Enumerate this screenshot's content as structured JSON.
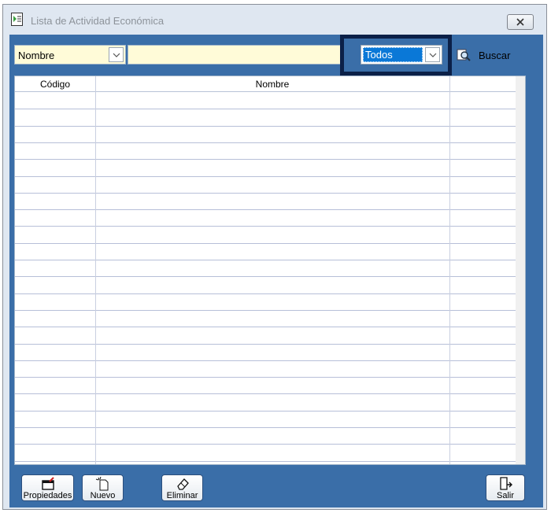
{
  "window": {
    "title": "Lista de Actividad Económica"
  },
  "search": {
    "field_value": "Nombre",
    "text_value": "",
    "filter_value": "Todos",
    "search_label": "Buscar"
  },
  "grid": {
    "columns": [
      "Código",
      "Nombre",
      ""
    ],
    "row_count": 22
  },
  "toolbar": {
    "properties_label": "Propiedades",
    "new_label": "Nuevo",
    "delete_label": "Eliminar",
    "exit_label": "Salir"
  },
  "colors": {
    "panel": "#3a6ea8",
    "input": "#fffbd8",
    "highlight": "#0b2048",
    "selection": "#0a78d7"
  }
}
